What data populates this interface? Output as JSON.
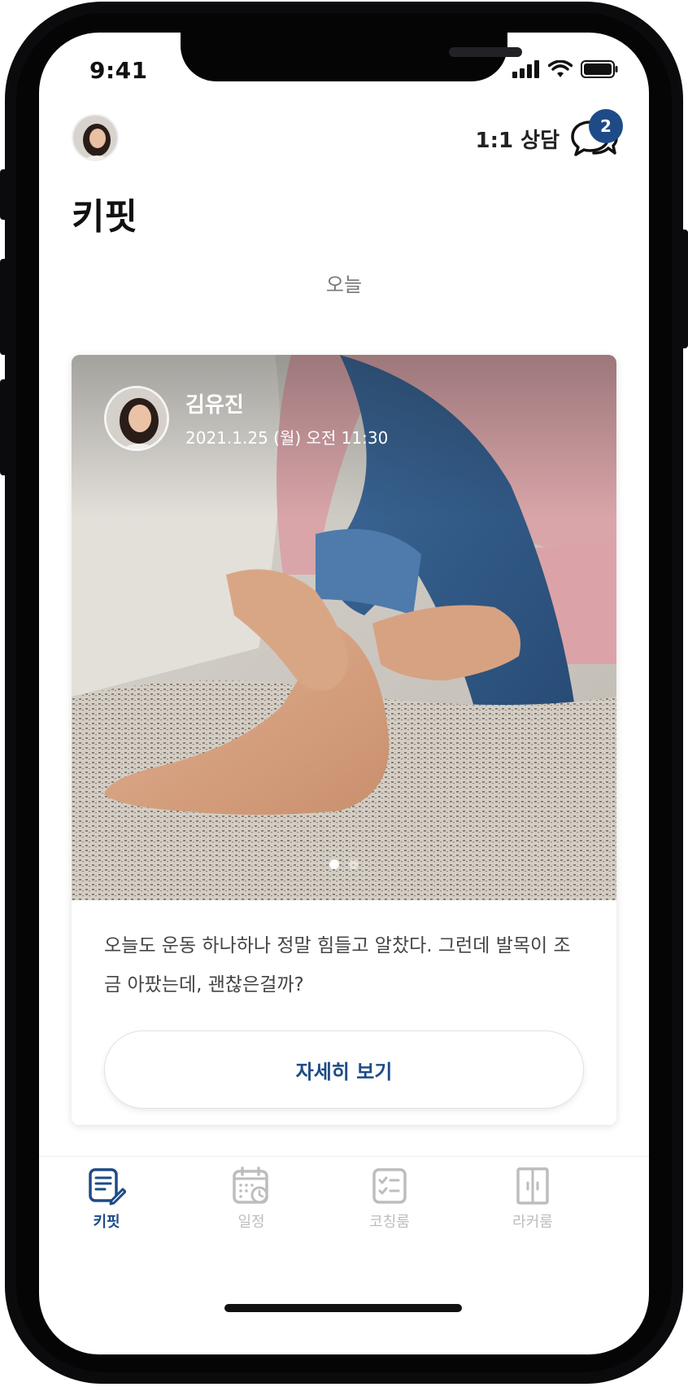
{
  "status_bar": {
    "time": "9:41"
  },
  "header": {
    "consult_label": "1:1 상담",
    "badge_count": "2",
    "page_title": "키핏"
  },
  "feed": {
    "date_label": "오늘",
    "post": {
      "author_name": "김유진",
      "timestamp": "2021.1.25 (월) 오전 11:30",
      "text": "오늘도 운동 하나하나 정말 힘들고 알찼다. 그런데 발목이 조금 아팠는데, 괜찮은걸까?",
      "detail_button": "자세히 보기",
      "carousel_index": 1,
      "carousel_total": 2
    }
  },
  "tabbar": {
    "items": [
      {
        "label": "키핏",
        "icon": "note-edit-icon",
        "active": true
      },
      {
        "label": "일정",
        "icon": "calendar-clock-icon",
        "active": false
      },
      {
        "label": "코칭룸",
        "icon": "checklist-icon",
        "active": false
      },
      {
        "label": "라커룸",
        "icon": "locker-icon",
        "active": false
      }
    ]
  },
  "colors": {
    "accent": "#1e4b87",
    "inactive": "#bdbdbd",
    "text_primary": "#111111",
    "text_secondary": "#777777"
  }
}
